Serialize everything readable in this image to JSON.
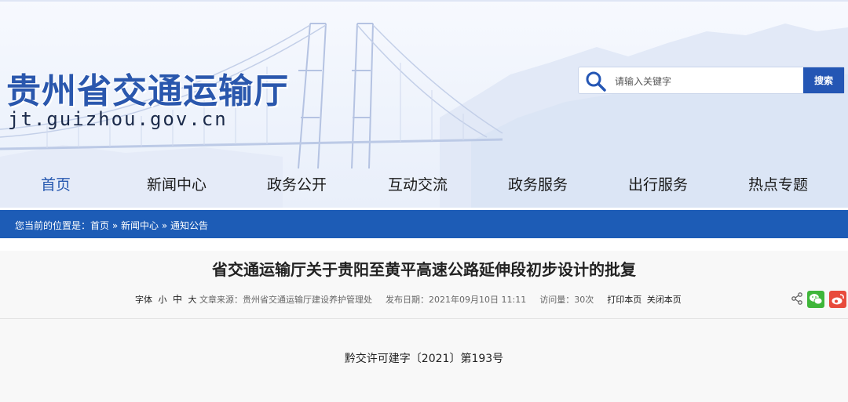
{
  "header": {
    "site_title": "贵州省交通运输厅",
    "site_domain": "jt.guizhou.gov.cn",
    "banner_image": "suspension-bridge-mountains-sketch"
  },
  "search": {
    "placeholder": "请输入关键字",
    "button_label": "搜索",
    "icon": "search-icon"
  },
  "nav": {
    "items": [
      {
        "label": "首页",
        "active": true
      },
      {
        "label": "新闻中心",
        "active": false
      },
      {
        "label": "政务公开",
        "active": false
      },
      {
        "label": "互动交流",
        "active": false
      },
      {
        "label": "政务服务",
        "active": false
      },
      {
        "label": "出行服务",
        "active": false
      },
      {
        "label": "热点专题",
        "active": false
      }
    ]
  },
  "breadcrumb": {
    "prefix": "您当前的位置是：",
    "items": [
      "首页",
      "新闻中心",
      "通知公告"
    ],
    "separator": " » "
  },
  "article": {
    "title": "省交通运输厅关于贵阳至黄平高速公路延伸段初步设计的批复",
    "meta": {
      "font_label": "字体",
      "font_small": "小",
      "font_medium": "中",
      "font_large": "大",
      "source_label": "文章来源：",
      "source": "贵州省交通运输厅建设养护管理处",
      "date_label": "发布日期：",
      "date": "2021年09月10日 11:11",
      "views_label": "访问量：",
      "views": "30次",
      "print_label": "打印本页",
      "close_label": "关闭本页"
    },
    "share_icons": [
      "share-icon",
      "wechat-icon",
      "weibo-icon"
    ],
    "doc_number": "黔交许可建字〔2021〕第193号"
  },
  "colors": {
    "brand_blue": "#1d5cb6",
    "title_blue": "#2a57ad",
    "search_button": "#2456b4",
    "wechat_green": "#3fb63a",
    "weibo_red": "#e84b3c"
  }
}
